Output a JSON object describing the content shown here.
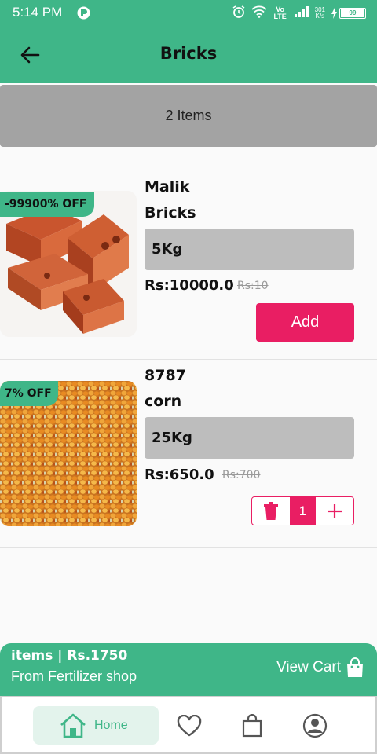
{
  "status_bar": {
    "time": "5:14 PM",
    "volte": "Vo LTE",
    "speed_value": "301",
    "speed_unit": "K/s",
    "battery": "99"
  },
  "header": {
    "title": "Bricks"
  },
  "items_count": "2 Items",
  "products": [
    {
      "discount": "-99900% OFF",
      "name_line1": "Malik",
      "name_line2": "Bricks",
      "weight": "5Kg",
      "price": "Rs:10000.0",
      "old_price": "Rs:10",
      "action_label": "Add"
    },
    {
      "discount": "7% OFF",
      "name_line1": "8787",
      "name_line2": "corn",
      "weight": "25Kg",
      "price": "Rs:650.0",
      "old_price": "Rs:700",
      "quantity": "1"
    }
  ],
  "cart": {
    "summary": "items | Rs.1750",
    "shop": "From Fertilizer shop",
    "view_cart_label": "View Cart"
  },
  "bottom_nav": {
    "home_label": "Home"
  },
  "colors": {
    "primary": "#3fb688",
    "accent": "#e91e63",
    "count_bar": "#a3a3a3",
    "weight_box": "#bdbdbd"
  }
}
